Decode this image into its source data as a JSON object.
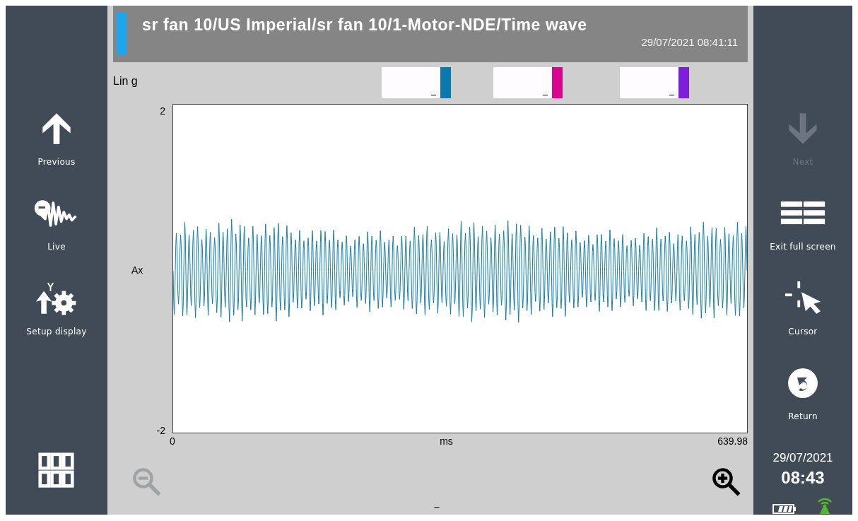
{
  "left_sidebar": {
    "items": [
      {
        "kind": "up",
        "label": "Previous",
        "disabled": false
      },
      {
        "kind": "live",
        "label": "Live",
        "disabled": false
      },
      {
        "kind": "setup",
        "label": "Setup display",
        "disabled": false
      }
    ]
  },
  "header": {
    "title": "sr fan 10/US Imperial/sr fan 10/1-Motor-NDE/Time wave",
    "timestamp": "29/07/2021 08:41:11"
  },
  "units": "Lin g",
  "cursors": [
    {
      "value": "_",
      "color": "#0a7aae"
    },
    {
      "value": "_",
      "color": "#d6068e"
    },
    {
      "value": "_",
      "color": "#7d1fd8"
    }
  ],
  "chart": {
    "y_max": "2",
    "y_min": "-2",
    "channel": "Ax",
    "x_min": "0",
    "x_label": "ms",
    "x_max": "639.98"
  },
  "zoom_out": {
    "disabled": true
  },
  "zoom_in": {
    "disabled": false
  },
  "bottom_value": "_",
  "right_sidebar": {
    "items": [
      {
        "kind": "down",
        "label": "Next",
        "disabled": true
      },
      {
        "kind": "exit",
        "label": "Exit full screen",
        "disabled": false
      },
      {
        "kind": "cursor",
        "label": "Cursor",
        "disabled": false
      },
      {
        "kind": "return",
        "label": "Return",
        "disabled": false
      }
    ]
  },
  "clock": {
    "date": "29/07/2021",
    "time": "08:43"
  }
}
